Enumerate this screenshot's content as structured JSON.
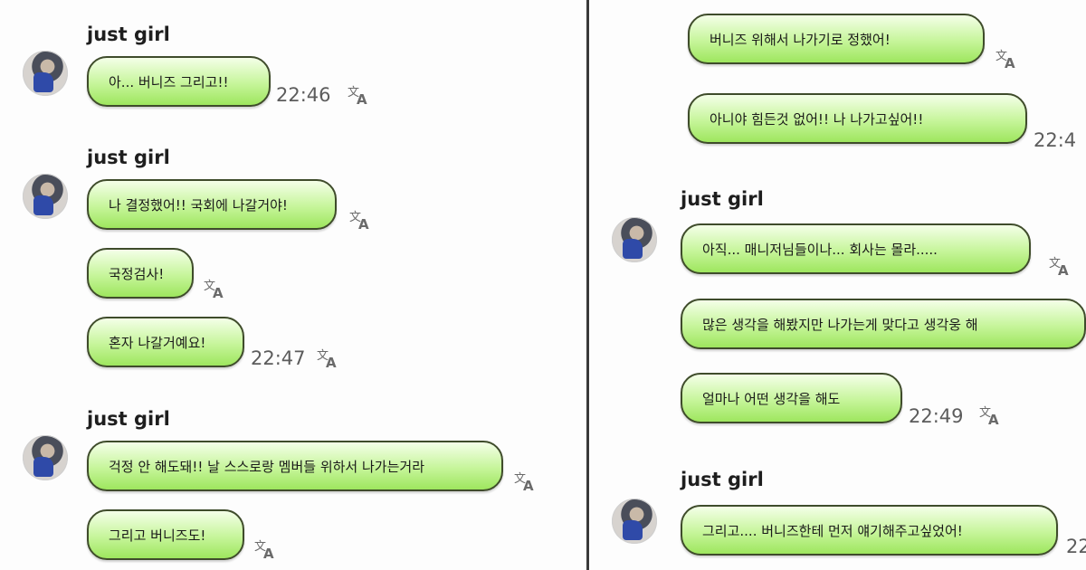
{
  "left": {
    "groups": [
      {
        "sender": "just girl",
        "messages": [
          {
            "text": "아... 버니즈 그리고!!",
            "time": "22:46"
          }
        ]
      },
      {
        "sender": "just girl",
        "messages": [
          {
            "text": "나 결정했어!! 국회에 나갈거야!",
            "time": ""
          },
          {
            "text": "국정검사!",
            "time": ""
          },
          {
            "text": "혼자 나갈거예요!",
            "time": "22:47"
          }
        ]
      },
      {
        "sender": "just girl",
        "messages": [
          {
            "text": "걱정 안 해도돼!! 날 스스로랑 멤버들 위하서 나가는거라",
            "time": ""
          },
          {
            "text": "그리고 버니즈도!",
            "time": ""
          }
        ]
      }
    ]
  },
  "right": {
    "top_messages": [
      {
        "text": "버니즈 위해서 나가기로 정했어!",
        "time": ""
      },
      {
        "text": "아니야 힘든것 없어!! 나 나가고싶어!!",
        "time": "22:4"
      }
    ],
    "groups": [
      {
        "sender": "just girl",
        "messages": [
          {
            "text": "아직... 매니저님들이나... 회사는 몰라.....",
            "time": ""
          },
          {
            "text": "많은 생각을 해봤지만 나가는게 맞다고 생각웅 해",
            "time": ""
          },
          {
            "text": "얼마나 어떤 생각을 해도",
            "time": "22:49"
          }
        ]
      },
      {
        "sender": "just girl",
        "messages": [
          {
            "text": "그리고.... 버니즈한테 먼저 얘기해주고싶었어!",
            "time": "22"
          }
        ]
      }
    ]
  },
  "icons": {
    "translate": "translate-icon",
    "translate_glyph_1": "文",
    "translate_glyph_2": "A"
  },
  "colors": {
    "bubble_border": "#3f4c2b",
    "bubble_fill": "#c6f59a",
    "divider": "#3a3a3a"
  }
}
